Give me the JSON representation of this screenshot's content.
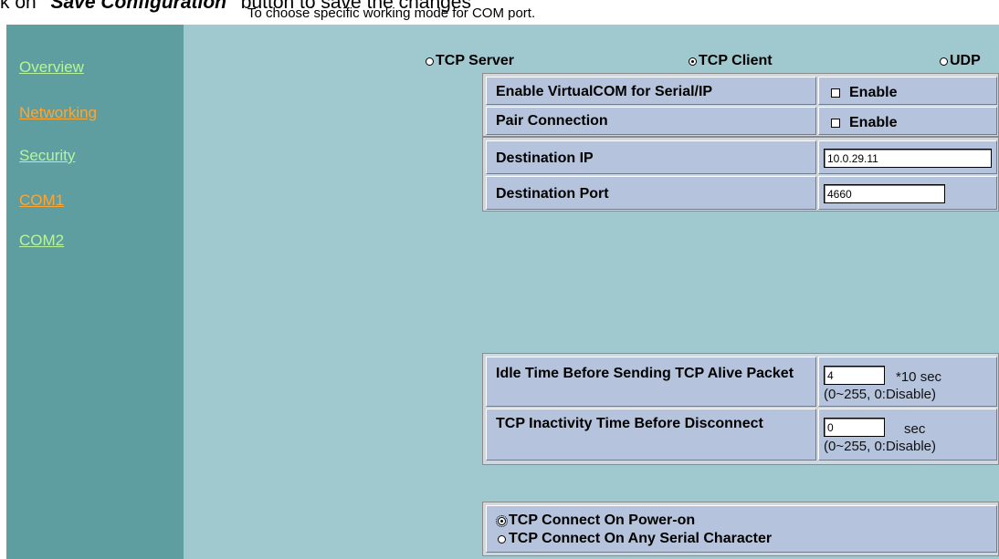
{
  "header": {
    "instruction_prefix": "k on ",
    "instruction_bold": "\"Save Configuration\"",
    "instruction_suffix": " button to save the changes",
    "subtitle": "To choose specific working mode for COM port."
  },
  "sidebar": {
    "items": [
      {
        "label": "Overview"
      },
      {
        "label": "Networking"
      },
      {
        "label": "Security"
      },
      {
        "label": "COM1"
      },
      {
        "label": "COM2"
      }
    ]
  },
  "modes": {
    "tcp_server": "TCP Server",
    "tcp_client": "TCP Client",
    "udp": "UDP",
    "selected": "TCP Client"
  },
  "settings": {
    "virtualcom_label": "Enable VirtualCOM for Serial/IP",
    "virtualcom_checkbox": "Enable",
    "pair_label": "Pair Connection",
    "pair_checkbox": "Enable",
    "dest_ip_label": "Destination IP",
    "dest_ip_value": "10.0.29.11",
    "dest_port_label": "Destination Port",
    "dest_port_value": "4660"
  },
  "timers": {
    "idle_label": "Idle Time Before Sending TCP Alive Packet",
    "idle_value": "4",
    "idle_unit": "*10 sec",
    "idle_range": "(0~255, 0:Disable)",
    "inactivity_label": "TCP Inactivity Time Before Disconnect",
    "inactivity_value": "0",
    "inactivity_unit": "sec",
    "inactivity_range": "(0~255, 0:Disable)"
  },
  "connect": {
    "on_power": "TCP Connect On Power-on",
    "on_serial": "TCP Connect On Any Serial Character",
    "selected": "TCP Connect On Power-on"
  }
}
